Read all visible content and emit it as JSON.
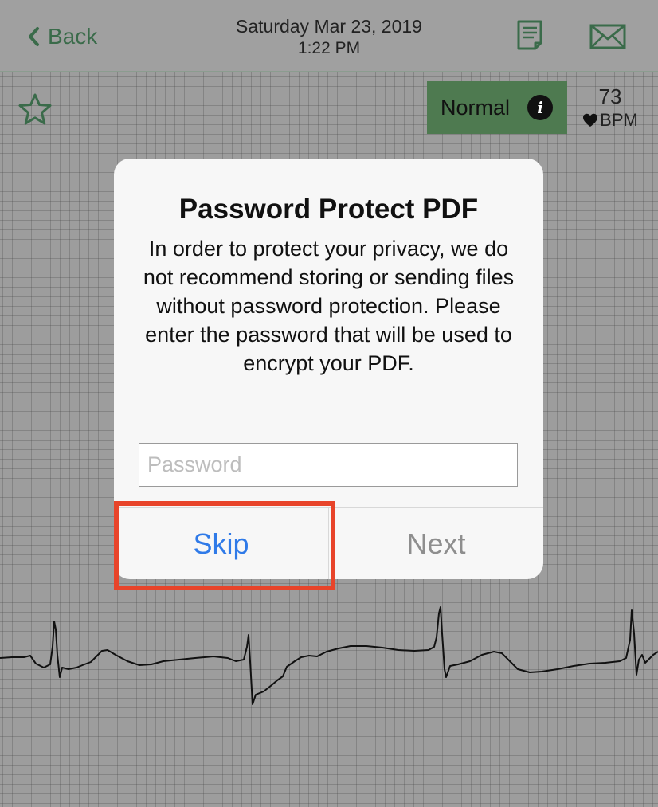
{
  "header": {
    "back_label": "Back",
    "date": "Saturday Mar 23, 2019",
    "time": "1:22 PM"
  },
  "recording": {
    "status_label": "Normal",
    "bpm_value": "73",
    "bpm_unit": "BPM"
  },
  "dialog": {
    "title": "Password Protect PDF",
    "message": "In order to protect your privacy, we do not recommend storing or sending files without password protection. Please enter the password that will be used to encrypt your PDF.",
    "password_placeholder": "Password",
    "password_value": "",
    "skip_label": "Skip",
    "next_label": "Next"
  },
  "colors": {
    "accent_green": "#3a6b4a",
    "status_green": "#4e7a50",
    "link_blue": "#2f7ae8",
    "disabled_gray": "#8e8e8e",
    "highlight_red": "#e8442a"
  }
}
